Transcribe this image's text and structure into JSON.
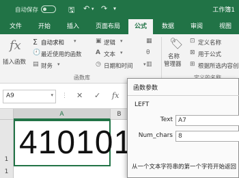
{
  "titlebar": {
    "autosave": "自动保存",
    "toggle": "关",
    "workbook": "工作簿1"
  },
  "tabs": [
    "文件",
    "开始",
    "插入",
    "页面布局",
    "公式",
    "数据",
    "审阅",
    "视图"
  ],
  "active_tab": "公式",
  "ribbon": {
    "insert_function": "插入函数",
    "autosum": "自动求和",
    "recent": "最近使用的函数",
    "financial": "财务",
    "logical": "逻辑",
    "text": "文本",
    "datetime": "日期和时间",
    "library_label": "函数库",
    "name_manager_1": "名称",
    "name_manager_2": "管理器",
    "define_name": "定义名称",
    "use_in_formula": "用于公式",
    "create_from_selection": "根据所选内容创",
    "defined_names_label": "定义的名称"
  },
  "formula_bar": {
    "name_box": "A9"
  },
  "grid": {
    "columns": [
      "A",
      "B"
    ],
    "selected_column": "A",
    "rows": [
      "1",
      "1",
      "1"
    ],
    "cell_value": "410101"
  },
  "dialog": {
    "title": "函数参数",
    "function": "LEFT",
    "args": [
      {
        "label": "Text",
        "value": "A7"
      },
      {
        "label": "Num_chars",
        "value": "8"
      }
    ],
    "description": "从一个文本字符串的第一个字符开始返回"
  },
  "colors": {
    "accent": "#217346",
    "ribbon_bg": "#f3f3f3"
  }
}
